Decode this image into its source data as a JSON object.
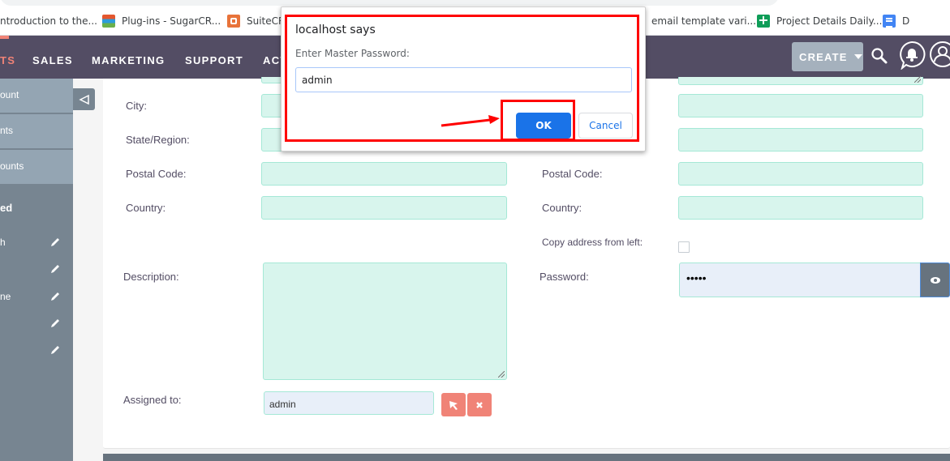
{
  "browser": {
    "bookmarks": [
      {
        "label": "ntroduction to the...",
        "icon": "none"
      },
      {
        "label": "Plug-ins - SugarCR...",
        "icon": "layers-icon"
      },
      {
        "label": "SuiteCR",
        "icon": "suitecrm-icon"
      },
      {
        "label": "email template vari...",
        "icon": "none"
      },
      {
        "label": "Project Details Daily...",
        "icon": "sheets-icon"
      },
      {
        "label": "D",
        "icon": "docs-icon"
      }
    ]
  },
  "nav": {
    "items": [
      {
        "label": "TS",
        "active": true
      },
      {
        "label": "SALES",
        "active": false
      },
      {
        "label": "MARKETING",
        "active": false
      },
      {
        "label": "SUPPORT",
        "active": false
      },
      {
        "label": "ACT",
        "active": false
      }
    ],
    "create_label": "CREATE",
    "accent_color": "#f08377"
  },
  "sidebar": {
    "actions": [
      {
        "label": "ount"
      },
      {
        "label": "nts"
      },
      {
        "label": "ounts"
      }
    ],
    "recent_heading": "ed",
    "recent_items": [
      {
        "label": "h"
      },
      {
        "label": ""
      },
      {
        "label": "ne"
      },
      {
        "label": ""
      },
      {
        "label": ""
      }
    ]
  },
  "form": {
    "left": {
      "city_label": "City:",
      "state_label": "State/Region:",
      "postal_label": "Postal Code:",
      "country_label": "Country:",
      "description_label": "Description:",
      "assigned_label": "Assigned to:",
      "assigned_value": "admin"
    },
    "right": {
      "postal_label": "Postal Code:",
      "country_label": "Country:",
      "copy_label": "Copy address from left:",
      "copy_checked": false,
      "password_label": "Password:",
      "password_value": "•••••"
    }
  },
  "dialog": {
    "title": "localhost says",
    "message": "Enter Master Password:",
    "input_value": "admin",
    "ok_label": "OK",
    "cancel_label": "Cancel"
  },
  "annotations": {
    "color": "#ff0000"
  }
}
